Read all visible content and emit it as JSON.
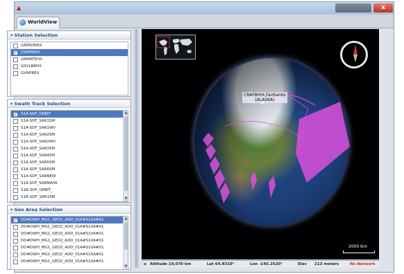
{
  "window": {
    "close_label": "x",
    "tab_label": "WorldView"
  },
  "station_panel": {
    "title": "Station Selection",
    "items": [
      {
        "label": "GRMSPREX",
        "checked": false,
        "selected": false
      },
      {
        "label": "CRAFBHIX",
        "checked": true,
        "selected": true
      },
      {
        "label": "GRMATEHX",
        "checked": false,
        "selected": false
      },
      {
        "label": "GSVLBRHX",
        "checked": false,
        "selected": false
      },
      {
        "label": "GVNPREX",
        "checked": false,
        "selected": false
      }
    ]
  },
  "swath_panel": {
    "title": "Swath Track Selection",
    "items": [
      {
        "label": "S1A-SDF_ORBIT",
        "checked": true,
        "selected": true
      },
      {
        "label": "S1A-SDF_SAR1SM",
        "checked": false,
        "selected": false
      },
      {
        "label": "S1A-SDF_SAR1WV",
        "checked": false,
        "selected": false
      },
      {
        "label": "S1A-SDF_SAR2SM",
        "checked": false,
        "selected": false
      },
      {
        "label": "S1A-SDF_SAR2WV",
        "checked": false,
        "selected": false
      },
      {
        "label": "S1A-SDF_SAR3SM",
        "checked": false,
        "selected": false
      },
      {
        "label": "S1A-SDF_SAR4SM",
        "checked": false,
        "selected": false
      },
      {
        "label": "S1A-SDF_SAR5SM",
        "checked": false,
        "selected": false
      },
      {
        "label": "S1A-SDF_SAR6SM",
        "checked": false,
        "selected": false
      },
      {
        "label": "S1A-SDF_SARNEW",
        "checked": false,
        "selected": false
      },
      {
        "label": "S1A-SDF_SARNWW",
        "checked": false,
        "selected": false
      },
      {
        "label": "S1B-SDF_ORBIT_",
        "checked": false,
        "selected": false
      },
      {
        "label": "S1B-SDF_SAR1SM",
        "checked": false,
        "selected": false
      }
    ]
  },
  "geo_panel": {
    "title": "Geo Area Selection",
    "items": [
      {
        "label": "DO#DWH_MG1_GEO2_ADD_01A#S10A#01",
        "checked": true,
        "selected": true
      },
      {
        "label": "DO#DWH_MG1_GEO2_ADD_01A#S10A#01",
        "checked": false,
        "selected": false
      },
      {
        "label": "DO#DWH_MG1_GEO2_ADD_01A#S10A#01",
        "checked": false,
        "selected": false
      },
      {
        "label": "DO#DWH_MG1_GEO2_ADD_01A#S10A#01",
        "checked": false,
        "selected": false
      },
      {
        "label": "DO#DWH_MG1_GEO2_ADD_01A#S10A#01",
        "checked": false,
        "selected": false
      },
      {
        "label": "DO#DWH_MG1_GEO2_ADD_01A#S10A#01",
        "checked": false,
        "selected": false
      },
      {
        "label": "DO#DWH_MG1_GEO2_ADD_01A#S10A#01",
        "checked": false,
        "selected": false
      }
    ]
  },
  "viewer": {
    "ground_station_label_line1": "CRAFBHIX,Fairbanks",
    "ground_station_label_line2": "(ALASKA)",
    "scale_label": "2000 Km"
  },
  "statusbar": {
    "altitude": "Altitude 19,070 km",
    "lat": "Lat 64.9310°",
    "lon": "Lon -145.2520°",
    "elev_label": "Elev",
    "elev_value": "213 meters",
    "network": "No Network"
  },
  "colors": {
    "selection": "#4d79c0",
    "swath": "#dc50dc",
    "error": "#dd2222"
  }
}
